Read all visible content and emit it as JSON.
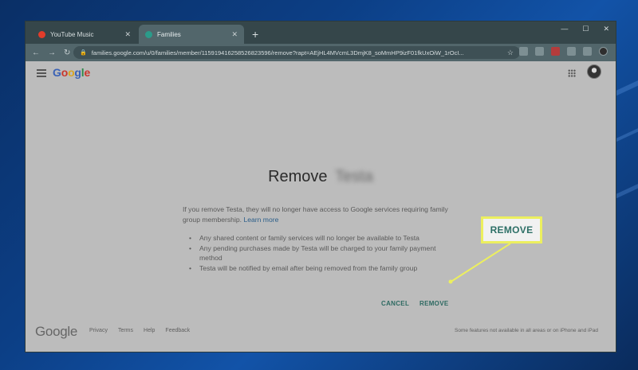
{
  "browser": {
    "tabs": [
      {
        "label": "YouTube Music",
        "icon": "youtube-music-icon",
        "active": false
      },
      {
        "label": "Families",
        "icon": "families-icon",
        "active": true
      }
    ],
    "new_tab": "+",
    "url": "families.google.com/u/0/families/member/115919416258526823596/remove?rapt=AEjHL4MVcmL3DmjK8_soMmHP9izF01fkUxOiW_1rOcI..."
  },
  "header": {
    "logo_letters": [
      "G",
      "o",
      "o",
      "g",
      "l",
      "e"
    ]
  },
  "dialog": {
    "title_prefix": "Remove",
    "title_name": "Testa",
    "intro": "If you remove Testa, they will no longer have access to Google services requiring family group membership.",
    "learn_more": "Learn more",
    "bullets": [
      "Any shared content or family services will no longer be available to Testa",
      "Any pending purchases made by Testa will be charged to your family payment method",
      "Testa will be notified by email after being removed from the family group"
    ],
    "cancel_label": "CANCEL",
    "remove_label": "REMOVE"
  },
  "callout": {
    "label": "REMOVE",
    "color": "#ecef5e"
  },
  "footer": {
    "logo": "Google",
    "links": [
      "Privacy",
      "Terms",
      "Help",
      "Feedback"
    ],
    "note": "Some features not available in all areas or on iPhone and iPad"
  }
}
